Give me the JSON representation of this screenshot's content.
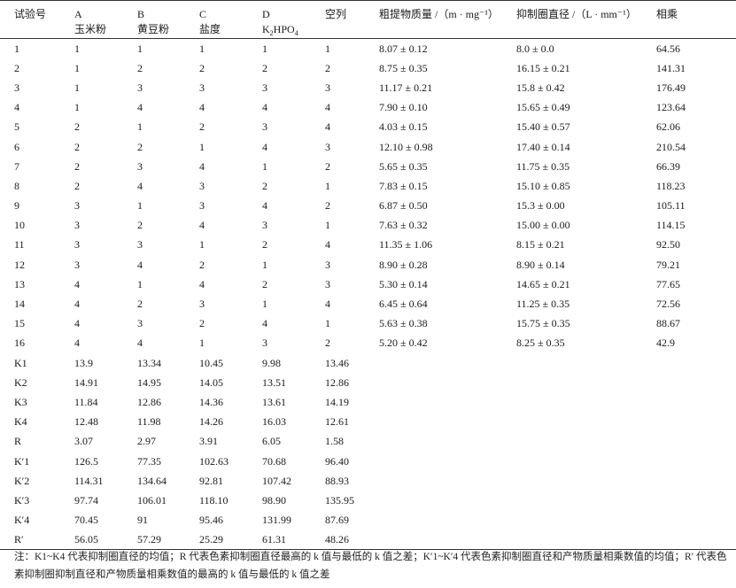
{
  "table": {
    "headers": {
      "trial": "试验号",
      "a_letter": "A",
      "a_name": "玉米粉",
      "b_letter": "B",
      "b_name": "黄豆粉",
      "c_letter": "C",
      "c_name": "盐度",
      "d_letter": "D",
      "d_name_pre": "K",
      "d_name_sub": "2",
      "d_name_mid": "HPO",
      "d_name_sub2": "4",
      "empty": "空列",
      "mass": "粗提物质量 /（m · mg⁻¹）",
      "diameter": "抑制圈直径 /（L · mm⁻¹）",
      "product": "相乘"
    },
    "rows": [
      [
        "1",
        "1",
        "1",
        "1",
        "1",
        "1",
        "8.07 ± 0.12",
        "8.0 ± 0.0",
        "64.56"
      ],
      [
        "2",
        "1",
        "2",
        "2",
        "2",
        "2",
        "8.75 ± 0.35",
        "16.15 ± 0.21",
        "141.31"
      ],
      [
        "3",
        "1",
        "3",
        "3",
        "3",
        "3",
        "11.17 ± 0.21",
        "15.8 ± 0.42",
        "176.49"
      ],
      [
        "4",
        "1",
        "4",
        "4",
        "4",
        "4",
        "7.90 ± 0.10",
        "15.65 ± 0.49",
        "123.64"
      ],
      [
        "5",
        "2",
        "1",
        "2",
        "3",
        "4",
        "4.03 ± 0.15",
        "15.40 ± 0.57",
        "62.06"
      ],
      [
        "6",
        "2",
        "2",
        "1",
        "4",
        "3",
        "12.10 ± 0.98",
        "17.40 ± 0.14",
        "210.54"
      ],
      [
        "7",
        "2",
        "3",
        "4",
        "1",
        "2",
        "5.65 ± 0.35",
        "11.75 ± 0.35",
        "66.39"
      ],
      [
        "8",
        "2",
        "4",
        "3",
        "2",
        "1",
        "7.83 ± 0.15",
        "15.10 ± 0.85",
        "118.23"
      ],
      [
        "9",
        "3",
        "1",
        "3",
        "4",
        "2",
        "6.87 ± 0.50",
        "15.3 ± 0.00",
        "105.11"
      ],
      [
        "10",
        "3",
        "2",
        "4",
        "3",
        "1",
        "7.63 ± 0.32",
        "15.00 ± 0.00",
        "114.15"
      ],
      [
        "11",
        "3",
        "3",
        "1",
        "2",
        "4",
        "11.35 ± 1.06",
        "8.15 ± 0.21",
        "92.50"
      ],
      [
        "12",
        "3",
        "4",
        "2",
        "1",
        "3",
        "8.90 ± 0.28",
        "8.90 ± 0.14",
        "79.21"
      ],
      [
        "13",
        "4",
        "1",
        "4",
        "2",
        "3",
        "5.30 ± 0.14",
        "14.65 ± 0.21",
        "77.65"
      ],
      [
        "14",
        "4",
        "2",
        "3",
        "1",
        "4",
        "6.45 ± 0.64",
        "11.25 ± 0.35",
        "72.56"
      ],
      [
        "15",
        "4",
        "3",
        "2",
        "4",
        "1",
        "5.63 ± 0.38",
        "15.75 ± 0.35",
        "88.67"
      ],
      [
        "16",
        "4",
        "4",
        "1",
        "3",
        "2",
        "5.20 ± 0.42",
        "8.25 ± 0.35",
        "42.9"
      ],
      [
        "K1",
        "13.9",
        "13.34",
        "10.45",
        "9.98",
        "13.46",
        "",
        "",
        ""
      ],
      [
        "K2",
        "14.91",
        "14.95",
        "14.05",
        "13.51",
        "12.86",
        "",
        "",
        ""
      ],
      [
        "K3",
        "11.84",
        "12.86",
        "14.36",
        "13.61",
        "14.19",
        "",
        "",
        ""
      ],
      [
        "K4",
        "12.48",
        "11.98",
        "14.26",
        "16.03",
        "12.61",
        "",
        "",
        ""
      ],
      [
        "R",
        "3.07",
        "2.97",
        "3.91",
        "6.05",
        "1.58",
        "",
        "",
        ""
      ],
      [
        "K′1",
        "126.5",
        "77.35",
        "102.63",
        "70.68",
        "96.40",
        "",
        "",
        ""
      ],
      [
        "K′2",
        "114.31",
        "134.64",
        "92.81",
        "107.42",
        "88.93",
        "",
        "",
        ""
      ],
      [
        "K′3",
        "97.74",
        "106.01",
        "118.10",
        "98.90",
        "135.95",
        "",
        "",
        ""
      ],
      [
        "K′4",
        "70.45",
        "91",
        "95.46",
        "131.99",
        "87.69",
        "",
        "",
        ""
      ],
      [
        "R′",
        "56.05",
        "57.29",
        "25.29",
        "61.31",
        "48.26",
        "",
        "",
        ""
      ]
    ]
  },
  "note": "注：K1~K4 代表抑制圈直径的均值；R 代表色素抑制圈直径最高的 k 值与最低的 k 值之差；K′1~K′4 代表色素抑制圈直径和产物质量相乘数值的均值；R′ 代表色素抑制圈抑制直径和产物质量相乘数值的最高的 k 值与最低的 k 值之差"
}
